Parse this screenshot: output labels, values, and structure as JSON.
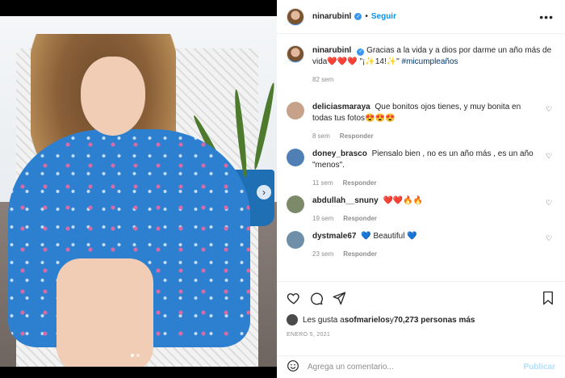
{
  "header": {
    "username": "ninarubinl",
    "separator": "•",
    "follow_label": "Seguir",
    "more_label": "•••",
    "verified_icon": "check-verified-icon"
  },
  "media": {
    "next_icon": "›",
    "dots": 2,
    "active_dot": 0
  },
  "caption": {
    "user": "ninarubinl",
    "text": "Gracias a la vida y a dios por darme un año más de vida",
    "emoji": "❤️❤️❤️",
    "tail": " \"¡✨14!✨\" ",
    "hashtag": "#micumpleaños",
    "time": "82 sem"
  },
  "comments": [
    {
      "user": "deliciasmaraya",
      "text": "Que bonitos ojos tienes, y muy bonita en todas tus fotos😍😍😍",
      "time": "8 sem",
      "reply": "Responder",
      "avatar_color": "#c6a28a"
    },
    {
      "user": "doney_brasco",
      "text": "Piensalo bien , no es un año más , es un año \"menos\".",
      "time": "11 sem",
      "reply": "Responder",
      "avatar_color": "#4f7fb4"
    },
    {
      "user": "abdullah__snuny",
      "text": "❤️❤️🔥🔥",
      "time": "19 sem",
      "reply": "Responder",
      "avatar_color": "#7d8a6a"
    },
    {
      "user": "dystmale67",
      "text": "💙 Beautiful 💙",
      "time": "23 sem",
      "reply": "Responder",
      "avatar_color": "#6f8fa8"
    }
  ],
  "actions": {
    "like_icon": "heart-icon",
    "comment_icon": "comment-icon",
    "share_icon": "send-icon",
    "save_icon": "bookmark-icon"
  },
  "likes": {
    "prefix": "Les gusta a ",
    "user": "sofmarielos",
    "middle": " y ",
    "count": "70,273 personas más"
  },
  "date": "ENERO 5, 2021",
  "add_comment": {
    "placeholder": "Agrega un comentario...",
    "publish_label": "Publicar",
    "emoji_icon": "smiley-icon"
  }
}
